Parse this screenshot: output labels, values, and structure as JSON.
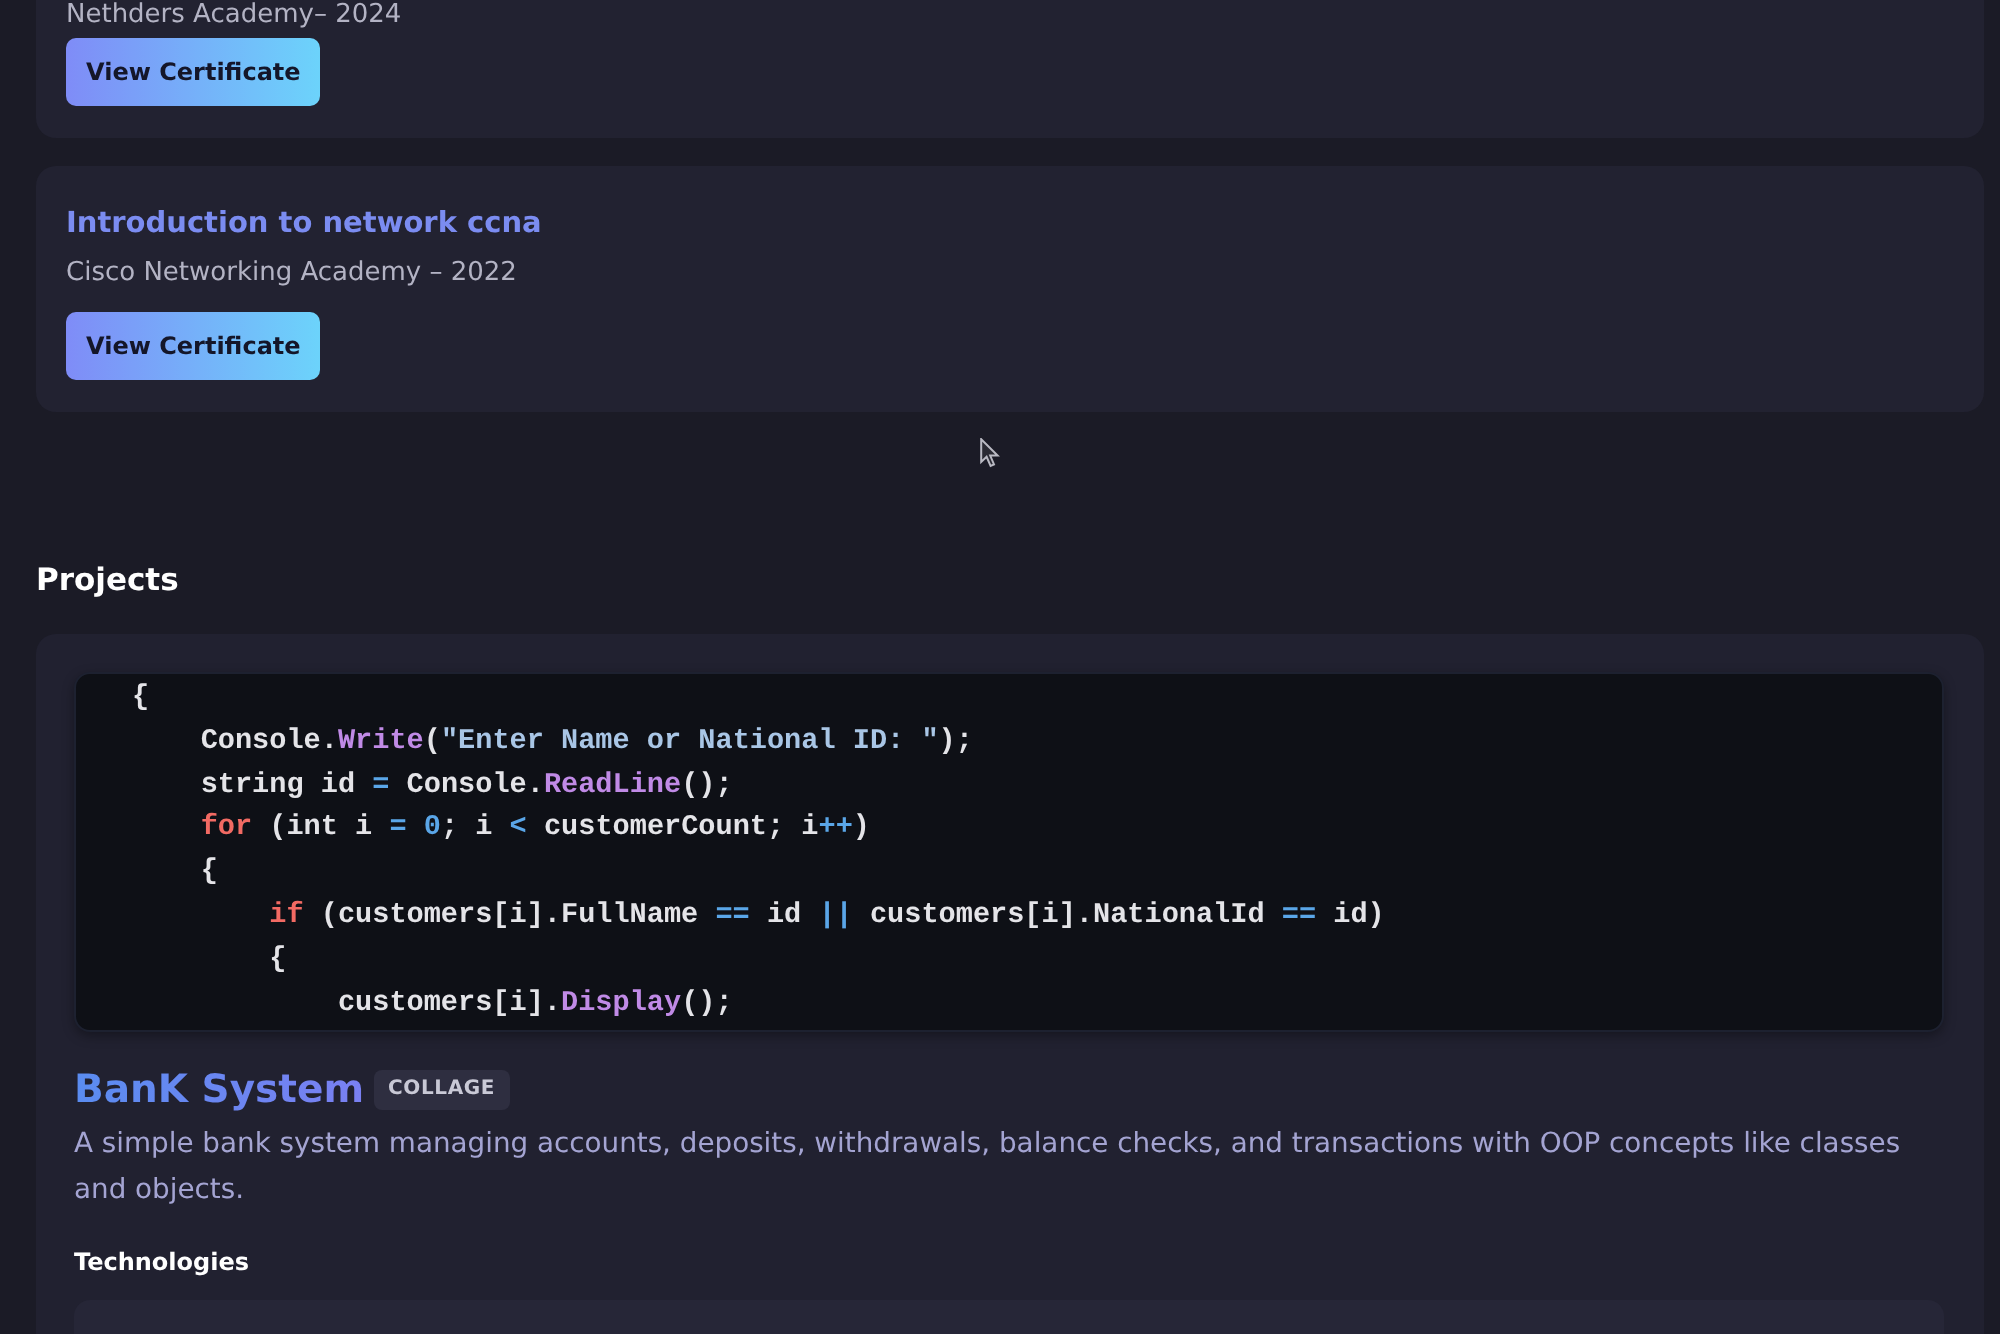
{
  "certificates": [
    {
      "issuer": "Nethders Academy– 2024",
      "button": "View Certificate"
    },
    {
      "title": "Introduction to network ccna",
      "issuer": "Cisco Networking Academy – 2022",
      "button": "View Certificate"
    }
  ],
  "projects": {
    "heading": "Projects",
    "items": [
      {
        "code_lines": [
          [
            {
              "text": "{",
              "kind": "plain"
            }
          ],
          [
            {
              "text": "    Console.",
              "kind": "plain"
            },
            {
              "text": "Write",
              "kind": "method"
            },
            {
              "text": "(",
              "kind": "plain"
            },
            {
              "text": "\"Enter Name or National ID: \"",
              "kind": "string"
            },
            {
              "text": ");",
              "kind": "plain"
            }
          ],
          [
            {
              "text": "    string id ",
              "kind": "plain"
            },
            {
              "text": "=",
              "kind": "operator"
            },
            {
              "text": " Console.",
              "kind": "plain"
            },
            {
              "text": "ReadLine",
              "kind": "method"
            },
            {
              "text": "();",
              "kind": "plain"
            }
          ],
          [
            {
              "text": "    for",
              "kind": "keyword"
            },
            {
              "text": " (int i ",
              "kind": "plain"
            },
            {
              "text": "=",
              "kind": "operator"
            },
            {
              "text": " 0",
              "kind": "number"
            },
            {
              "text": "; i ",
              "kind": "plain"
            },
            {
              "text": "<",
              "kind": "operator"
            },
            {
              "text": " customerCount; i",
              "kind": "plain"
            },
            {
              "text": "++",
              "kind": "operator"
            },
            {
              "text": ")",
              "kind": "plain"
            }
          ],
          [
            {
              "text": "    {",
              "kind": "plain"
            }
          ],
          [
            {
              "text": "        if",
              "kind": "keyword"
            },
            {
              "text": " (customers[i].FullName ",
              "kind": "plain"
            },
            {
              "text": "==",
              "kind": "operator"
            },
            {
              "text": " id ",
              "kind": "plain"
            },
            {
              "text": "||",
              "kind": "operator"
            },
            {
              "text": " customers[i].NationalId ",
              "kind": "plain"
            },
            {
              "text": "==",
              "kind": "operator"
            },
            {
              "text": " id)",
              "kind": "plain"
            }
          ],
          [
            {
              "text": "        {",
              "kind": "plain"
            }
          ],
          [
            {
              "text": "            customers[i].",
              "kind": "plain"
            },
            {
              "text": "Display",
              "kind": "method"
            },
            {
              "text": "();",
              "kind": "plain"
            }
          ]
        ],
        "title": "BanK System",
        "badge": "COLLAGE",
        "description": "A simple bank system managing accounts, deposits, withdrawals, balance checks, and transactions with OOP concepts like classes and objects.",
        "technologies_heading": "Technologies"
      }
    ]
  }
}
